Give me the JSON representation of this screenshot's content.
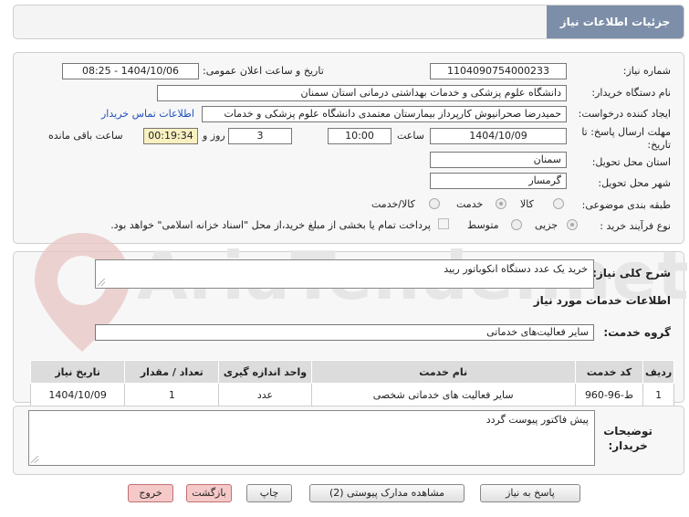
{
  "header": {
    "title": "جزئیات اطلاعات نیاز"
  },
  "form": {
    "need_number_label": "شماره نیاز:",
    "need_number": "1104090754000233",
    "announce_label": "تاریخ و ساعت اعلان عمومی:",
    "announce_value": "1404/10/06 - 08:25",
    "buyer_label": "نام دستگاه خریدار:",
    "buyer_value": "دانشگاه علوم پزشکی و خدمات بهداشتی  درمانی استان سمنان",
    "creator_label": "ایجاد کننده درخواست:",
    "creator_value": "حمیدرضا صحرانیوش کارپرداز بیمارستان معتمدی دانشگاه علوم پزشکی و خدمات",
    "contact_link": "اطلاعات تماس خریدار",
    "deadline_label": "مهلت ارسال پاسخ: تا تاریخ:",
    "deadline_date": "1404/10/09",
    "time_label": "ساعت",
    "deadline_time": "10:00",
    "days_value": "3",
    "days_label": "روز و",
    "remaining_time": "00:19:34",
    "remaining_label": "ساعت باقی مانده",
    "province_label": "استان محل تحویل:",
    "province_value": "سمنان",
    "city_label": "شهر محل تحویل:",
    "city_value": "گرمسار",
    "category_label": "طبقه بندی موضوعی:",
    "category_options": [
      "کالا",
      "خدمت",
      "کالا/خدمت"
    ],
    "process_label": "نوع فرآیند خرید :",
    "process_options": [
      "جزیی",
      "متوسط"
    ],
    "payment_note": "پرداخت تمام یا بخشی از مبلغ خرید،از محل \"اسناد خزانه اسلامی\" خواهد بود."
  },
  "summary": {
    "label": "شرح کلی نیاز:",
    "value": "خرید یک عدد دستگاه انکوباتور ریید"
  },
  "services": {
    "section_title": "اطلاعات خدمات مورد نیاز",
    "group_label": "گروه خدمت:",
    "group_value": "سایر فعالیت‌های خدماتی",
    "columns": [
      "ردیف",
      "کد خدمت",
      "نام خدمت",
      "واحد اندازه گیری",
      "تعداد / مقدار",
      "تاریخ نیاز"
    ],
    "rows": [
      [
        "1",
        "ط-96-960",
        "سایر فعالیت های خدماتی شخصی",
        "عدد",
        "1",
        "1404/10/09"
      ]
    ]
  },
  "buyer_notes": {
    "label_line1": "توضیحات",
    "label_line2": "خریدار:",
    "value": "پیش فاکتور پیوست گردد"
  },
  "buttons": {
    "reply": "پاسخ به نیاز",
    "attachments": "مشاهده مدارک پیوستی (2)",
    "print": "چاپ",
    "back": "بازگشت",
    "exit": "خروج"
  },
  "watermark": "AriaTender.net",
  "colors": {
    "title_bg": "#7d8ea8",
    "time_bg": "#f8f0c0",
    "link": "#1f4fbf",
    "danger_btn": "#f6c9c9"
  }
}
